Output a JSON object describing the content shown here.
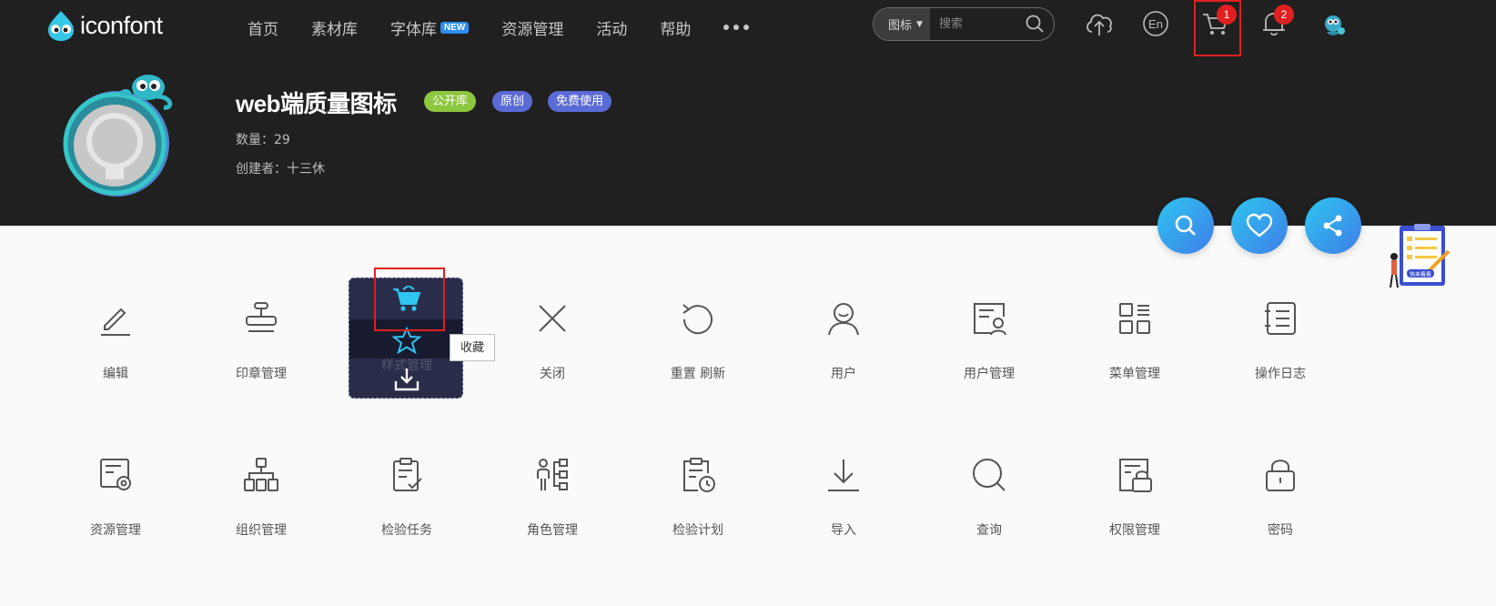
{
  "header": {
    "logo_text": "iconfont",
    "nav": [
      {
        "label": "首页"
      },
      {
        "label": "素材库"
      },
      {
        "label": "字体库",
        "badge": "NEW"
      },
      {
        "label": "资源管理"
      },
      {
        "label": "活动"
      },
      {
        "label": "帮助"
      }
    ],
    "search": {
      "type_label": "图标",
      "placeholder": "搜索"
    },
    "lang_label": "En",
    "cart_count": "1",
    "notify_count": "2"
  },
  "library": {
    "title": "web端质量图标",
    "tags": [
      "公开库",
      "原创",
      "免费使用"
    ],
    "count_label": "数量：",
    "count_value": "29",
    "creator_label": "创建者：",
    "creator_value": "十三休"
  },
  "promo_text": "快来看看",
  "icons_row1": [
    {
      "label": "编辑",
      "icon": "edit-icon"
    },
    {
      "label": "印章管理",
      "icon": "stamp-icon"
    },
    {
      "label": "样式管理",
      "icon": "style-icon"
    },
    {
      "label": "关闭",
      "icon": "close-icon"
    },
    {
      "label": "重置 刷新",
      "icon": "refresh-icon"
    },
    {
      "label": "用户",
      "icon": "user-icon"
    },
    {
      "label": "用户管理",
      "icon": "user-manage-icon"
    },
    {
      "label": "菜单管理",
      "icon": "menu-manage-icon"
    },
    {
      "label": "操作日志",
      "icon": "log-icon"
    }
  ],
  "icons_row2": [
    {
      "label": "资源管理",
      "icon": "resource-icon"
    },
    {
      "label": "组织管理",
      "icon": "org-icon"
    },
    {
      "label": "检验任务",
      "icon": "task-icon"
    },
    {
      "label": "角色管理",
      "icon": "role-icon"
    },
    {
      "label": "检验计划",
      "icon": "plan-icon"
    },
    {
      "label": "导入",
      "icon": "import-icon"
    },
    {
      "label": "查询",
      "icon": "query-icon"
    },
    {
      "label": "权限管理",
      "icon": "permission-icon"
    },
    {
      "label": "密码",
      "icon": "lock-icon"
    }
  ],
  "tooltip": "收藏",
  "colors": {
    "accent": "#2ec6f0",
    "brand_green": "#8dc63f",
    "tag_purple": "#5b6bd6",
    "badge_red": "#e02020"
  }
}
